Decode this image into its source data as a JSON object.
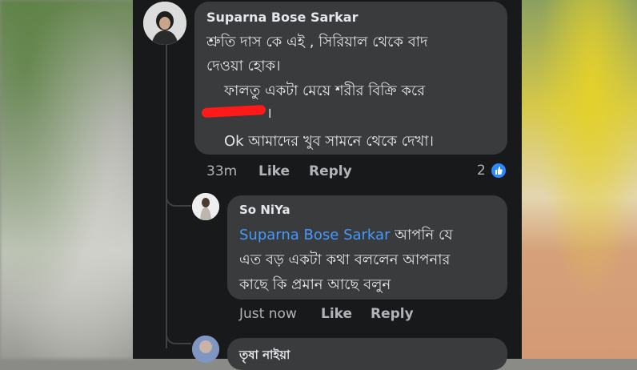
{
  "comment": {
    "author": "Suparna Bose Sarkar",
    "lines": [
      "শ্রুতি দাস কে এই , সিরিয়াল থেকে বাদ",
      "দেওয়া হোক।",
      "ফালতু একটা মেয়ে শরীর বিক্রি করে",
      "।",
      "Ok আমাদের খুব সামনে থেকে দেখা।"
    ],
    "time": "33m",
    "like_label": "Like",
    "reply_label": "Reply",
    "reaction_count": "2",
    "reaction_icon": "thumbs-up-icon"
  },
  "reply1": {
    "author": "So NiYa",
    "mention": "Suparna Bose Sarkar",
    "line1_rest": " আপনি যে",
    "line2": "এত বড় একটা কথা বললেন আপনার",
    "line3": "কাছে কি প্রমান আছে বলুন",
    "time": "Just now",
    "like_label": "Like",
    "reply_label": "Reply"
  },
  "reply2": {
    "author": "তৃষা নাইয়া"
  },
  "colors": {
    "panel_bg": "#18191a",
    "bubble_bg": "#3a3b3c",
    "text": "#e4e6eb",
    "meta": "#b0b3b8",
    "mention": "#4599ff",
    "like_badge": "#2d88ff",
    "redaction": "#ff1a1a"
  }
}
